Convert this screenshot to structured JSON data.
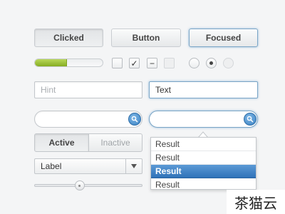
{
  "buttons": {
    "clicked": "Clicked",
    "normal": "Button",
    "focused": "Focused"
  },
  "progress": {
    "value": 0.46,
    "fill_color": "#9cc33b"
  },
  "checkboxes": [
    {
      "state": "unchecked",
      "glyph": ""
    },
    {
      "state": "checked",
      "glyph": "✓"
    },
    {
      "state": "indeterminate",
      "glyph": "−"
    },
    {
      "state": "disabled",
      "glyph": ""
    }
  ],
  "radios": [
    {
      "state": "unselected"
    },
    {
      "state": "selected"
    },
    {
      "state": "disabled"
    }
  ],
  "text_fields": {
    "hint_placeholder": "Hint",
    "text_value": "Text"
  },
  "search": {
    "icon": "search-icon",
    "accent": "#3f86c7"
  },
  "segmented": {
    "active": "Active",
    "inactive": "Inactive"
  },
  "select": {
    "value": "Label",
    "icon": "triangle-down-icon"
  },
  "results": {
    "items": [
      "Result",
      "Result",
      "Result",
      "Result"
    ],
    "selected_index": 2,
    "highlight_color": "#3d7fc3"
  },
  "slider": {
    "value": 0.42
  },
  "watermark": {
    "text": "茶猫云"
  }
}
